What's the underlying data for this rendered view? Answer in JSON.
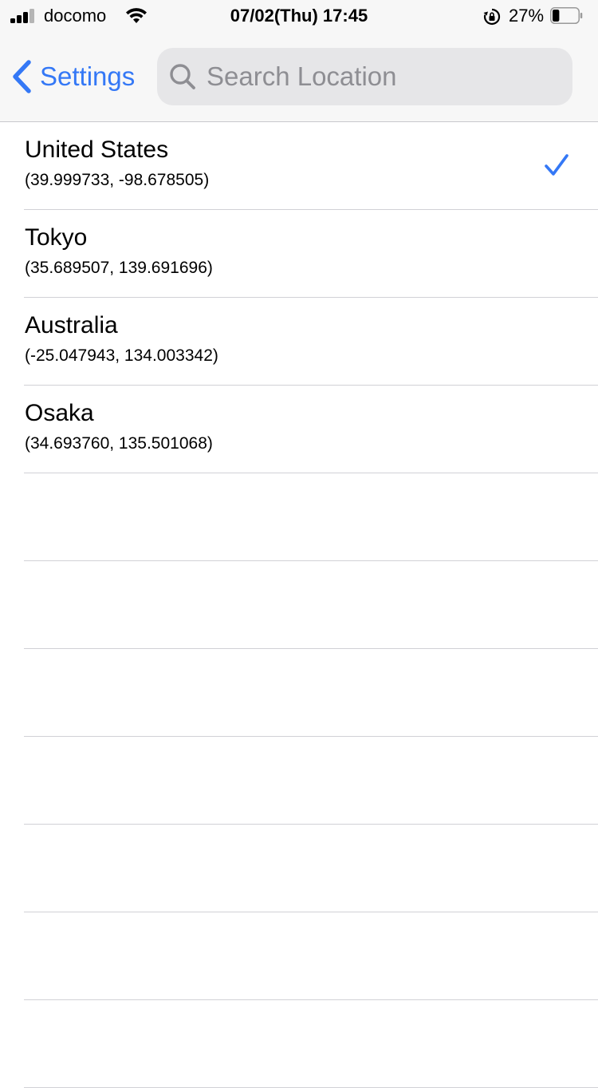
{
  "status_bar": {
    "carrier": "docomo",
    "time": "07/02(Thu) 17:45",
    "battery_percent": "27%",
    "battery_level": 0.27,
    "signal_icon": "signal-bars-icon",
    "wifi_icon": "wifi-icon",
    "lock_icon": "orientation-lock-icon"
  },
  "nav": {
    "back_label": "Settings",
    "search_placeholder": "Search Location",
    "search_value": ""
  },
  "accent_color": "#3478f6",
  "locations": [
    {
      "name": "United States",
      "coords": "(39.999733, -98.678505)",
      "selected": true
    },
    {
      "name": "Tokyo",
      "coords": "(35.689507, 139.691696)",
      "selected": false
    },
    {
      "name": "Australia",
      "coords": "(-25.047943, 134.003342)",
      "selected": false
    },
    {
      "name": "Osaka",
      "coords": "(34.693760, 135.501068)",
      "selected": false
    }
  ]
}
